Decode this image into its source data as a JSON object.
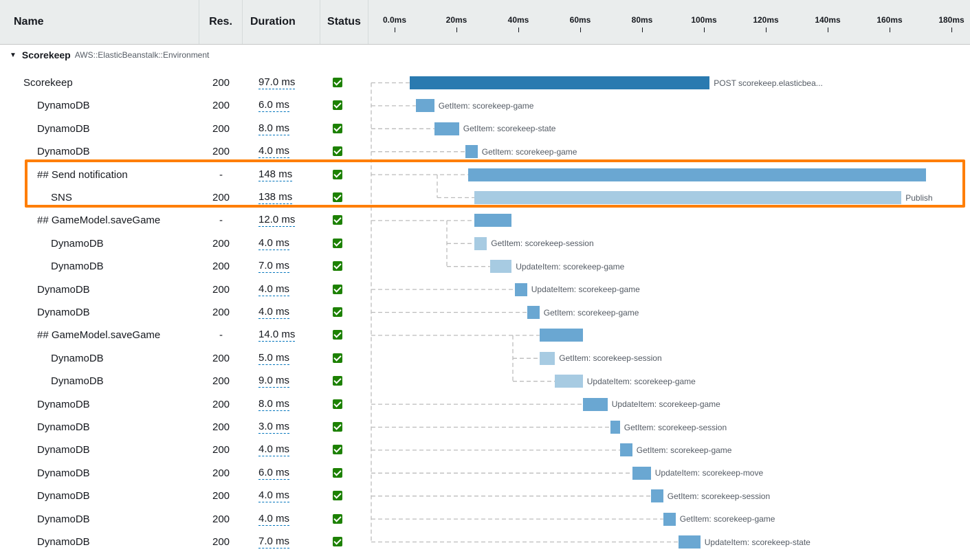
{
  "columns": {
    "name": "Name",
    "res": "Res.",
    "duration": "Duration",
    "status": "Status"
  },
  "timeline_ticks": [
    "0.0ms",
    "20ms",
    "40ms",
    "60ms",
    "80ms",
    "100ms",
    "120ms",
    "140ms",
    "160ms",
    "180ms"
  ],
  "group": {
    "name": "Scorekeep",
    "type": "AWS::ElasticBeanstalk::Environment"
  },
  "rows": [
    {
      "name": "Scorekeep",
      "depth": 0,
      "res": "200",
      "duration": "97.0 ms",
      "status": "ok",
      "start_ms": 7.5,
      "dur_ms": 97,
      "shade": "dark",
      "label": "POST scorekeep.elasticbea..."
    },
    {
      "name": "DynamoDB",
      "depth": 1,
      "res": "200",
      "duration": "6.0 ms",
      "status": "ok",
      "start_ms": 9.5,
      "dur_ms": 6,
      "shade": "mid",
      "label": "GetItem: scorekeep-game"
    },
    {
      "name": "DynamoDB",
      "depth": 1,
      "res": "200",
      "duration": "8.0 ms",
      "status": "ok",
      "start_ms": 15.5,
      "dur_ms": 8,
      "shade": "mid",
      "label": "GetItem: scorekeep-state"
    },
    {
      "name": "DynamoDB",
      "depth": 1,
      "res": "200",
      "duration": "4.0 ms",
      "status": "ok",
      "start_ms": 25.5,
      "dur_ms": 4,
      "shade": "mid",
      "label": "GetItem: scorekeep-game"
    },
    {
      "name": "## Send notification",
      "depth": 1,
      "res": "-",
      "duration": "148 ms",
      "status": "ok",
      "start_ms": 26.5,
      "dur_ms": 148,
      "shade": "mid",
      "label": ""
    },
    {
      "name": "SNS",
      "depth": 2,
      "res": "200",
      "duration": "138 ms",
      "status": "ok",
      "start_ms": 28.5,
      "dur_ms": 138,
      "shade": "light",
      "label": "Publish"
    },
    {
      "name": "## GameModel.saveGame",
      "depth": 1,
      "res": "-",
      "duration": "12.0 ms",
      "status": "ok",
      "start_ms": 28.5,
      "dur_ms": 12,
      "shade": "mid",
      "label": ""
    },
    {
      "name": "DynamoDB",
      "depth": 2,
      "res": "200",
      "duration": "4.0 ms",
      "status": "ok",
      "start_ms": 28.5,
      "dur_ms": 4,
      "shade": "light",
      "label": "GetItem: scorekeep-session"
    },
    {
      "name": "DynamoDB",
      "depth": 2,
      "res": "200",
      "duration": "7.0 ms",
      "status": "ok",
      "start_ms": 33.5,
      "dur_ms": 7,
      "shade": "light",
      "label": "UpdateItem: scorekeep-game"
    },
    {
      "name": "DynamoDB",
      "depth": 1,
      "res": "200",
      "duration": "4.0 ms",
      "status": "ok",
      "start_ms": 41.5,
      "dur_ms": 4,
      "shade": "mid",
      "label": "UpdateItem: scorekeep-game"
    },
    {
      "name": "DynamoDB",
      "depth": 1,
      "res": "200",
      "duration": "4.0 ms",
      "status": "ok",
      "start_ms": 45.5,
      "dur_ms": 4,
      "shade": "mid",
      "label": "GetItem: scorekeep-game"
    },
    {
      "name": "## GameModel.saveGame",
      "depth": 1,
      "res": "-",
      "duration": "14.0 ms",
      "status": "ok",
      "start_ms": 49.5,
      "dur_ms": 14,
      "shade": "mid",
      "label": ""
    },
    {
      "name": "DynamoDB",
      "depth": 2,
      "res": "200",
      "duration": "5.0 ms",
      "status": "ok",
      "start_ms": 49.5,
      "dur_ms": 5,
      "shade": "light",
      "label": "GetItem: scorekeep-session"
    },
    {
      "name": "DynamoDB",
      "depth": 2,
      "res": "200",
      "duration": "9.0 ms",
      "status": "ok",
      "start_ms": 54.5,
      "dur_ms": 9,
      "shade": "light",
      "label": "UpdateItem: scorekeep-game"
    },
    {
      "name": "DynamoDB",
      "depth": 1,
      "res": "200",
      "duration": "8.0 ms",
      "status": "ok",
      "start_ms": 63.5,
      "dur_ms": 8,
      "shade": "mid",
      "label": "UpdateItem: scorekeep-game"
    },
    {
      "name": "DynamoDB",
      "depth": 1,
      "res": "200",
      "duration": "3.0 ms",
      "status": "ok",
      "start_ms": 72.5,
      "dur_ms": 3,
      "shade": "mid",
      "label": "GetItem: scorekeep-session"
    },
    {
      "name": "DynamoDB",
      "depth": 1,
      "res": "200",
      "duration": "4.0 ms",
      "status": "ok",
      "start_ms": 75.5,
      "dur_ms": 4,
      "shade": "mid",
      "label": "GetItem: scorekeep-game"
    },
    {
      "name": "DynamoDB",
      "depth": 1,
      "res": "200",
      "duration": "6.0 ms",
      "status": "ok",
      "start_ms": 79.5,
      "dur_ms": 6,
      "shade": "mid",
      "label": "UpdateItem: scorekeep-move"
    },
    {
      "name": "DynamoDB",
      "depth": 1,
      "res": "200",
      "duration": "4.0 ms",
      "status": "ok",
      "start_ms": 85.5,
      "dur_ms": 4,
      "shade": "mid",
      "label": "GetItem: scorekeep-session"
    },
    {
      "name": "DynamoDB",
      "depth": 1,
      "res": "200",
      "duration": "4.0 ms",
      "status": "ok",
      "start_ms": 89.5,
      "dur_ms": 4,
      "shade": "mid",
      "label": "GetItem: scorekeep-game"
    },
    {
      "name": "DynamoDB",
      "depth": 1,
      "res": "200",
      "duration": "7.0 ms",
      "status": "ok",
      "start_ms": 94.5,
      "dur_ms": 7,
      "shade": "mid",
      "label": "UpdateItem: scorekeep-state"
    }
  ],
  "colors": {
    "dark": "#2a7ab0",
    "mid": "#6aa7d2",
    "light": "#a7cbe2",
    "highlight": "#ff7e00",
    "status_ok": "#1d8102"
  }
}
